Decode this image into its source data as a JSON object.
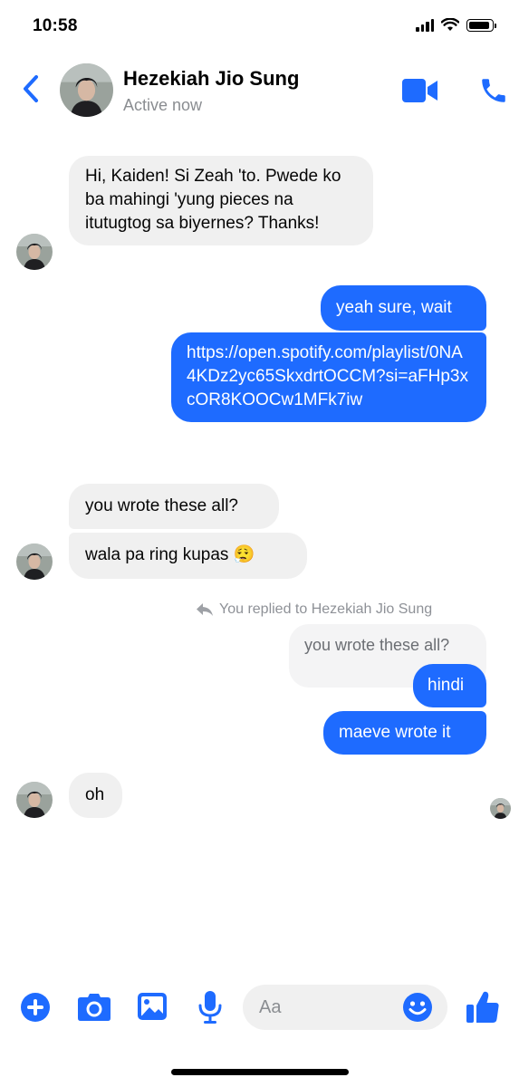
{
  "status_bar": {
    "time": "10:58"
  },
  "header": {
    "name": "Hezekiah Jio Sung",
    "status": "Active now",
    "icons": [
      "back-chevron-icon",
      "video-call-icon",
      "phone-icon"
    ]
  },
  "messages": {
    "m1": "Hi, Kaiden! Si Zeah 'to. Pwede ko ba mahingi 'yung pieces na itutugtog sa biyernes? Thanks!",
    "m2": "yeah sure, wait",
    "m3": "https://open.spotify.com/playlist/0NA4KDz2yc65SkxdrtOCCM?si=aFHp3xcOR8KOOCw1MFk7iw",
    "m4": "you wrote these all?",
    "m5": "wala pa ring kupas 😮‍💨",
    "reply_note": "You replied to Hezekiah Jio Sung",
    "m6_quoted": "you wrote these all?",
    "m7": "hindi",
    "m8": "maeve wrote it",
    "m9": "oh"
  },
  "composer": {
    "placeholder": "Aa",
    "icons": [
      "plus-icon",
      "camera-icon",
      "gallery-icon",
      "microphone-icon",
      "emoji-icon",
      "thumbs-up-icon"
    ]
  },
  "colors": {
    "accent": "#1e6bff",
    "incoming_bubble": "#f0f0f0"
  }
}
